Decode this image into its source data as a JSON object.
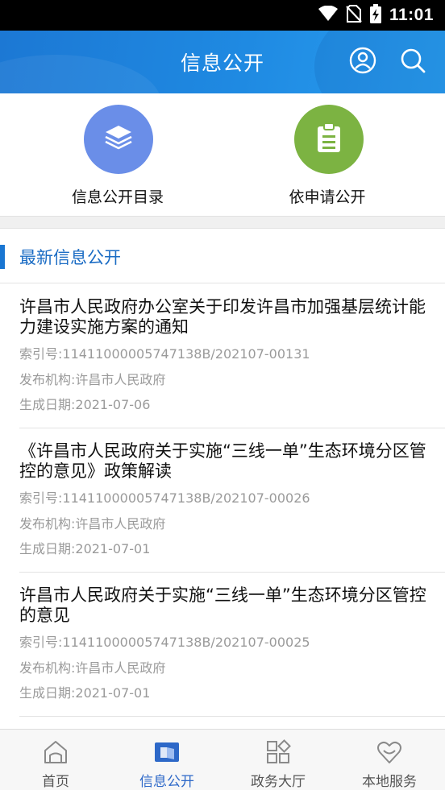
{
  "status_bar": {
    "time": "11:01",
    "icons": [
      "wifi-icon",
      "no-sim-icon",
      "battery-charging-icon"
    ]
  },
  "header": {
    "title": "信息公开",
    "icons": [
      "user-icon",
      "search-icon"
    ]
  },
  "quick_entries": [
    {
      "label": "信息公开目录",
      "icon": "layers-icon",
      "color": "#6a8ee8"
    },
    {
      "label": "依申请公开",
      "icon": "clipboard-icon",
      "color": "#7cb342"
    }
  ],
  "section": {
    "title": "最新信息公开",
    "accent": "#1976d2"
  },
  "news": [
    {
      "title": "许昌市人民政府办公室关于印发许昌市加强基层统计能力建设实施方案的通知",
      "code": "索引号:11411000005747138B/202107-00131",
      "org": "发布机构:许昌市人民政府",
      "date": "生成日期:2021-07-06"
    },
    {
      "title": "《许昌市人民政府关于实施“三线一单”生态环境分区管控的意见》政策解读",
      "code": "索引号:11411000005747138B/202107-00026",
      "org": "发布机构:许昌市人民政府",
      "date": "生成日期:2021-07-01"
    },
    {
      "title": "许昌市人民政府关于实施“三线一单”生态环境分区管控的意见",
      "code": "索引号:11411000005747138B/202107-00025",
      "org": "发布机构:许昌市人民政府",
      "date": "生成日期:2021-07-01"
    }
  ],
  "bottom_nav": [
    {
      "label": "首页",
      "icon": "home-icon",
      "active": false
    },
    {
      "label": "信息公开",
      "icon": "book-icon",
      "active": true
    },
    {
      "label": "政务大厅",
      "icon": "apps-grid-icon",
      "active": false
    },
    {
      "label": "本地服务",
      "icon": "heart-icon",
      "active": false
    }
  ],
  "colors": {
    "header": "#1f8ae2",
    "active_nav": "#2d68c8",
    "meta_text": "#9a9a9a"
  }
}
